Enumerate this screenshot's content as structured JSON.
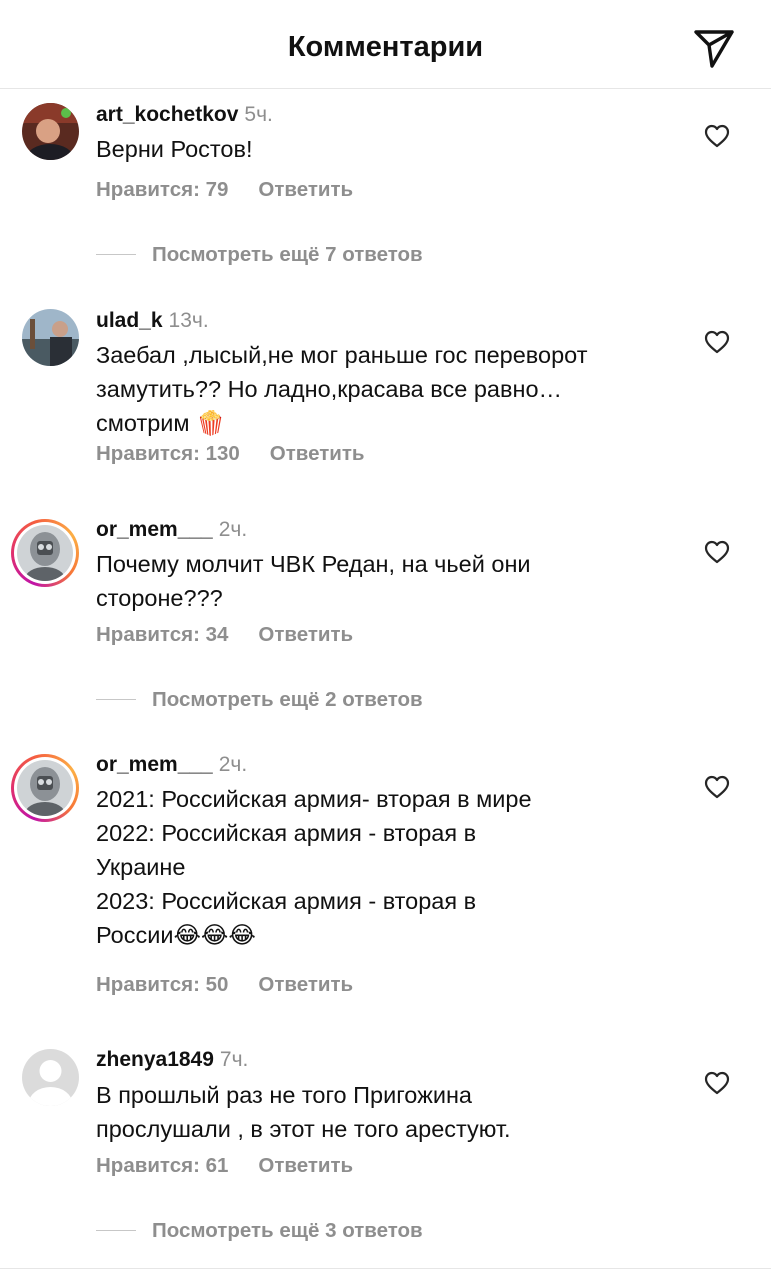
{
  "header": {
    "title": "Комментарии",
    "share_icon": "paper-plane-icon"
  },
  "comments": [
    {
      "username": "art_kochetkov",
      "time": "5ч.",
      "lines": [
        "Верни Ростов!"
      ],
      "likes": "Нравится: 79",
      "reply": "Ответить",
      "more": "Посмотреть ещё 7 ответов",
      "story_ring": false
    },
    {
      "username": "ulad_k",
      "time": "13ч.",
      "lines": [
        "Заебал ,лысый,не мог раньше гос переворот",
        "замутить?? Но ладно,красава все равно…",
        "смотрим 🍿"
      ],
      "likes": "Нравится: 130",
      "reply": "Ответить",
      "more": "",
      "story_ring": false
    },
    {
      "username": "or_mem___",
      "time": "2ч.",
      "lines": [
        "Почему молчит ЧВК Редан, на чьей они",
        "стороне???"
      ],
      "likes": "Нравится: 34",
      "reply": "Ответить",
      "more": "Посмотреть ещё 2 ответов",
      "story_ring": true
    },
    {
      "username": "or_mem___",
      "time": "2ч.",
      "lines": [
        "2021: Российская армия- вторая в мире",
        "2022: Российская армия - вторая в",
        "Украине",
        "2023: Российская армия - вторая в",
        "России😂😂😂"
      ],
      "likes": "Нравится: 50",
      "reply": "Ответить",
      "more": "",
      "story_ring": true
    },
    {
      "username": "zhenya1849",
      "time": "7ч.",
      "lines": [
        "В прошлый раз не того Пригожина",
        "прослушали , в этот не  того арестуют."
      ],
      "likes": "Нравится: 61",
      "reply": "Ответить",
      "more": "Посмотреть ещё 3 ответов",
      "story_ring": false
    }
  ],
  "colors": {
    "text": "#111111",
    "muted": "#8e8e8e",
    "divider": "#e6e6e6"
  }
}
